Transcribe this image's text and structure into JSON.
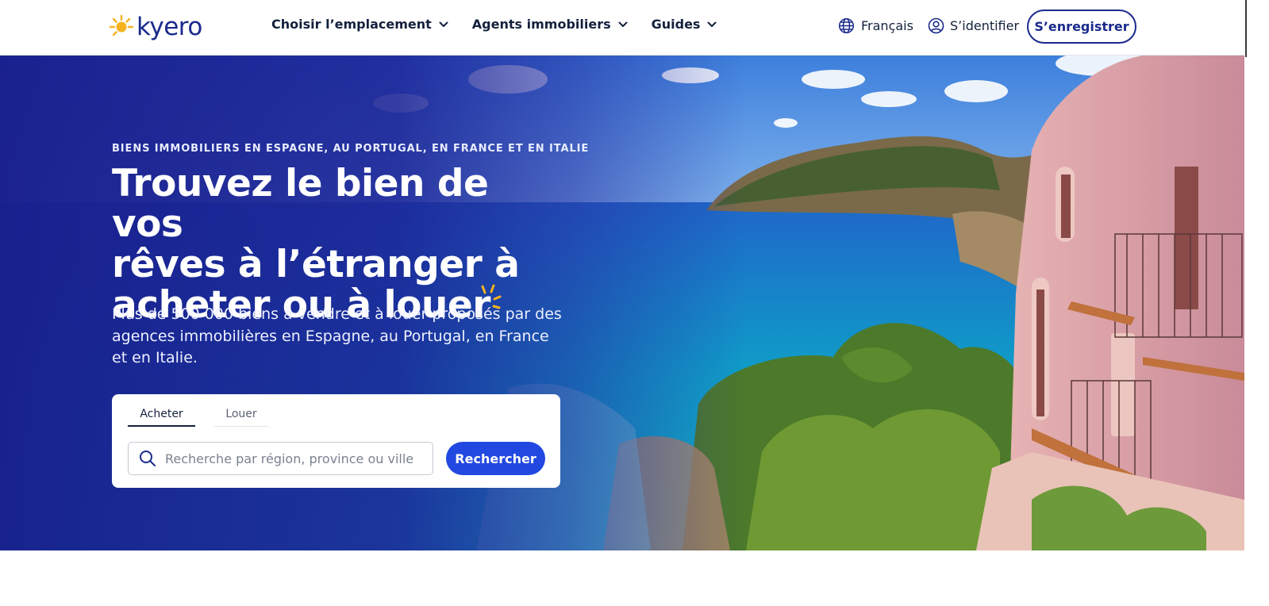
{
  "header": {
    "logo_text": "kyero",
    "nav": [
      {
        "label": "Choisir l’emplacement"
      },
      {
        "label": "Agents immobiliers"
      },
      {
        "label": "Guides"
      }
    ],
    "language_label": "Français",
    "login_label": "S’identifier",
    "register_label": "S’enregistrer"
  },
  "hero": {
    "eyebrow": "BIENS IMMOBILIERS EN ESPAGNE, AU PORTUGAL, EN FRANCE ET EN ITALIE",
    "headline_line1": "Trouvez le bien de vos",
    "headline_line2": "rêves à l’étranger à",
    "headline_line3": "acheter ou à louer",
    "subtext": "Plus de 500 000 biens à vendre et à louer proposés par des agences immobilières en Espagne, au Portugal, en France et en Italie."
  },
  "search": {
    "tabs": [
      {
        "label": "Acheter",
        "active": true
      },
      {
        "label": "Louer",
        "active": false
      }
    ],
    "placeholder": "Recherche par région, province ou ville",
    "value": "",
    "button_label": "Rechercher"
  },
  "colors": {
    "brand_navy": "#1a2a8c",
    "primary_blue": "#2148e0",
    "sun_yellow": "#f5b21e"
  },
  "icons": [
    "sun-logo-icon",
    "chevron-down-icon",
    "globe-icon",
    "user-circle-icon",
    "search-icon",
    "sparkle-icon"
  ]
}
